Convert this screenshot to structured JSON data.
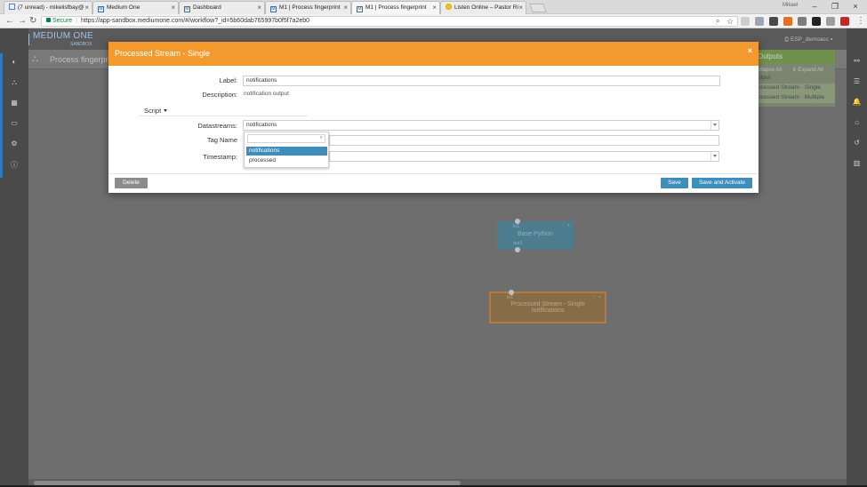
{
  "browser": {
    "tabs": [
      {
        "label": "(7 unread) - mikelisfbay@",
        "icon": "mail-icon"
      },
      {
        "label": "Medium One",
        "icon": "mediumone-icon"
      },
      {
        "label": "Dashboard",
        "icon": "mediumone-icon"
      },
      {
        "label": "M1 | Process fingerprint",
        "icon": "mediumone-icon"
      },
      {
        "label": "M1 | Process fingerprint",
        "icon": "mediumone-icon"
      },
      {
        "label": "Listen Online – Pastor Ri",
        "icon": "yellow-circle-icon"
      }
    ],
    "window_user": "Mikael",
    "secure_label": "Secure",
    "url": "https://app-sandbox.mediumone.com/#/workflow?_id=5b60dab765997b0f5f7a2eb0"
  },
  "app": {
    "logo_text": "MEDIUM ONE",
    "logo_sub": "SANDBOX",
    "user_menu": "ESP_demoacc",
    "workflow_title": "Process fingerprint",
    "outputs_panel": {
      "title": "Outputs",
      "collapse_label": "ollapse All",
      "expand_label": "Expand All",
      "items": [
        "utput",
        "ocessed Stream - Single",
        "ocessed Stream - Multiple"
      ]
    },
    "nodes": {
      "python": {
        "in_label": "in1",
        "title": "Base Python",
        "out_label": "out1"
      },
      "stream": {
        "in_label": "in1",
        "title": "Processed Stream - Single",
        "subtitle": "notifications"
      }
    }
  },
  "modal": {
    "title": "Processed Stream - Single",
    "close_glyph": "×",
    "label_label": "Label:",
    "label_value": "notifications",
    "description_label": "Description:",
    "description_value": "notification output",
    "script_label": "Script",
    "datastreams_label": "Datastreams:",
    "datastreams_value": "notifications",
    "tag_name_label": "Tag Name",
    "timestamp_label": "Timestamp:",
    "dropdown_options": [
      "notifications",
      "processed"
    ],
    "delete_label": "Delete",
    "save_label": "Save",
    "save_activate_label": "Save and Activate"
  }
}
